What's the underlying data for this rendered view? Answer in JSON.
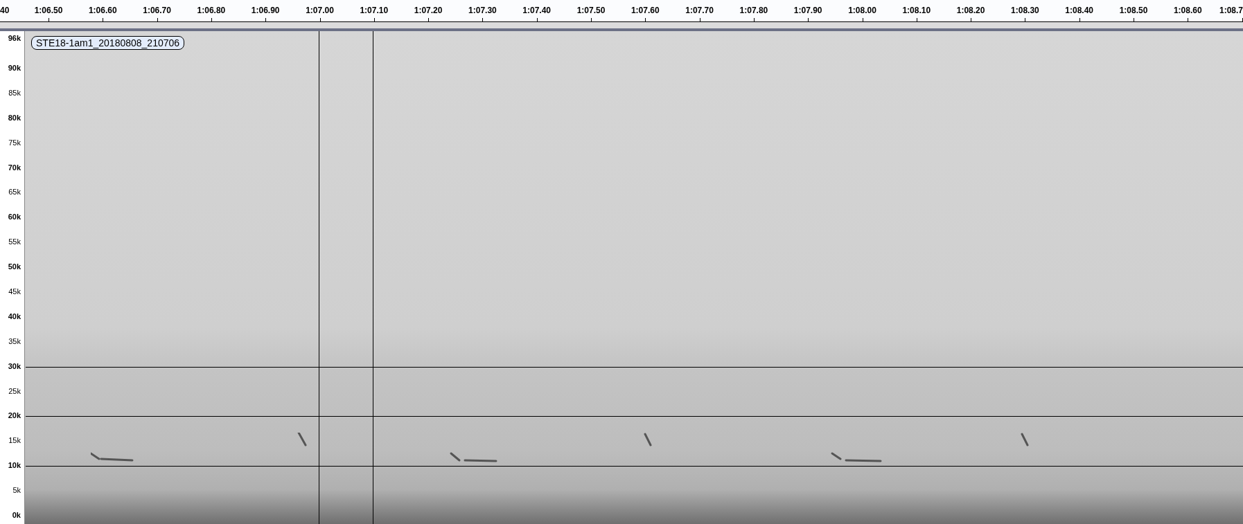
{
  "ruler": {
    "labels": [
      "40",
      "1:06.50",
      "1:06.60",
      "1:06.70",
      "1:06.80",
      "1:06.90",
      "1:07.00",
      "1:07.10",
      "1:07.20",
      "1:07.30",
      "1:07.40",
      "1:07.50",
      "1:07.60",
      "1:07.70",
      "1:07.80",
      "1:07.90",
      "1:08.00",
      "1:08.10",
      "1:08.20",
      "1:08.30",
      "1:08.40",
      "1:08.50",
      "1:08.60",
      "1:08.7"
    ]
  },
  "track": {
    "name": "STE18-1am1_20180808_210706",
    "axis": [
      {
        "label": "96k",
        "major": true
      },
      {
        "label": "90k",
        "major": true
      },
      {
        "label": "85k",
        "major": false
      },
      {
        "label": "80k",
        "major": true
      },
      {
        "label": "75k",
        "major": false
      },
      {
        "label": "70k",
        "major": true
      },
      {
        "label": "65k",
        "major": false
      },
      {
        "label": "60k",
        "major": true
      },
      {
        "label": "55k",
        "major": false
      },
      {
        "label": "50k",
        "major": true
      },
      {
        "label": "45k",
        "major": false
      },
      {
        "label": "40k",
        "major": true
      },
      {
        "label": "35k",
        "major": false
      },
      {
        "label": "30k",
        "major": true
      },
      {
        "label": "25k",
        "major": false
      },
      {
        "label": "20k",
        "major": true
      },
      {
        "label": "15k",
        "major": false
      },
      {
        "label": "10k",
        "major": true
      },
      {
        "label": "5k",
        "major": false
      },
      {
        "label": "0k",
        "major": true
      }
    ]
  }
}
